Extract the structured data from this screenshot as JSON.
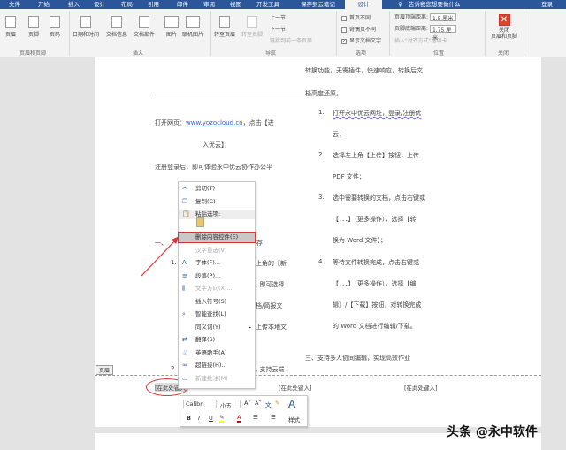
{
  "tabs": [
    "文件",
    "开始",
    "插入",
    "设计",
    "布局",
    "引用",
    "邮件",
    "审阅",
    "视图",
    "开发工具",
    "保存到云笔记",
    "设计"
  ],
  "active_tab": "设计",
  "tell_me": "告诉我您想要做什么",
  "login": "登录",
  "ribbon": {
    "hf_group": {
      "label": "页眉和页脚",
      "buttons": [
        "页眉",
        "页脚",
        "页码"
      ]
    },
    "insert_group": {
      "label": "插入",
      "buttons": [
        "日期和时间",
        "文档信息",
        "文档部件",
        "图片",
        "联机图片"
      ]
    },
    "nav_group": {
      "label": "导航",
      "buttons": [
        "转至页眉",
        "转至页脚"
      ],
      "small": [
        "上一节",
        "下一节",
        "链接到前一条页眉"
      ]
    },
    "options_group": {
      "label": "选项",
      "checks": [
        {
          "label": "首页不同",
          "checked": false
        },
        {
          "label": "奇偶页不同",
          "checked": false
        },
        {
          "label": "显示文档文字",
          "checked": true
        }
      ]
    },
    "position_group": {
      "label": "位置",
      "header_dist_label": "页眉顶端距离:",
      "header_dist": "1.5 厘米",
      "footer_dist_label": "页脚底端距离:",
      "footer_dist": "1.75 厘米",
      "insert_align": "插入\"对齐方式\"选项卡"
    },
    "close_group": {
      "label": "关闭",
      "button": "关闭\n页眉和页脚"
    }
  },
  "doc": {
    "left": [
      "打开网页：",
      "www.yozocloud.cn",
      "，点击【进",
      "入优云】，",
      "注册登录后，即可体验永中优云协作办公平",
      "一、",
      "存",
      "1.",
      "上角的【新",
      ", 即可选择",
      "档/简报文",
      "上传本地文",
      "2.",
      ", 支持云端"
    ],
    "right": [
      "转换功能，无需插件，快速响应，转换后文",
      "档高度还原。",
      "1.",
      "打开永中优云网址，登录/注册优",
      "云；",
      "2.",
      "选择左上角【上传】按钮，上传",
      "PDF 文件；",
      "3.",
      "选中需要转换的文档，点击右键或",
      "【．．．】（更多操作），选择【转",
      "换为 Word 文件】；",
      "4.",
      "等待文件转换完成，点击右键或",
      "【．．．】（更多操作），选择【编",
      "辑】/【下载】按钮，对转换完成",
      "的 Word 文档进行编辑/下载。",
      "三、支持多人协同编辑，实现高效作业"
    ],
    "header_tag": "页眉",
    "header_fields": [
      "[在此处键入]",
      "[在此处键入]",
      "[在此处键入]"
    ]
  },
  "context_menu": [
    {
      "label": "剪切(T)",
      "icon": "scissors-icon",
      "disabled": false
    },
    {
      "label": "复制(C)",
      "icon": "copy-icon",
      "disabled": false
    },
    {
      "label": "粘贴选项:",
      "icon": "paste-icon",
      "disabled": false
    },
    {
      "label": "删除内容控件(E)",
      "icon": "",
      "disabled": false,
      "highlighted": true
    },
    {
      "label": "汉字重选(V)",
      "icon": "",
      "disabled": true
    },
    {
      "label": "字体(F)...",
      "icon": "font-icon",
      "disabled": false
    },
    {
      "label": "段落(P)...",
      "icon": "paragraph-icon",
      "disabled": false
    },
    {
      "label": "文字方向(X)...",
      "icon": "text-direction-icon",
      "disabled": true
    },
    {
      "label": "插入符号(S)",
      "icon": "",
      "disabled": false
    },
    {
      "label": "智能查找(L)",
      "icon": "search-icon",
      "disabled": false
    },
    {
      "label": "同义词(Y)",
      "icon": "",
      "disabled": false,
      "submenu": true
    },
    {
      "label": "翻译(S)",
      "icon": "translate-icon",
      "disabled": false
    },
    {
      "label": "英语助手(A)",
      "icon": "english-assistant-icon",
      "disabled": false
    },
    {
      "label": "超链接(H)...",
      "icon": "hyperlink-icon",
      "disabled": false
    },
    {
      "label": "新建批注(M)",
      "icon": "comment-icon",
      "disabled": true
    }
  ],
  "mini_toolbar": {
    "font": "Calibri",
    "size": "小五",
    "styles": "样式",
    "bold": "B",
    "italic": "I",
    "underline": "U"
  },
  "watermark": "头条 @永中软件",
  "colors": {
    "brand": "#2b579a",
    "highlight_red": "#d33333"
  }
}
